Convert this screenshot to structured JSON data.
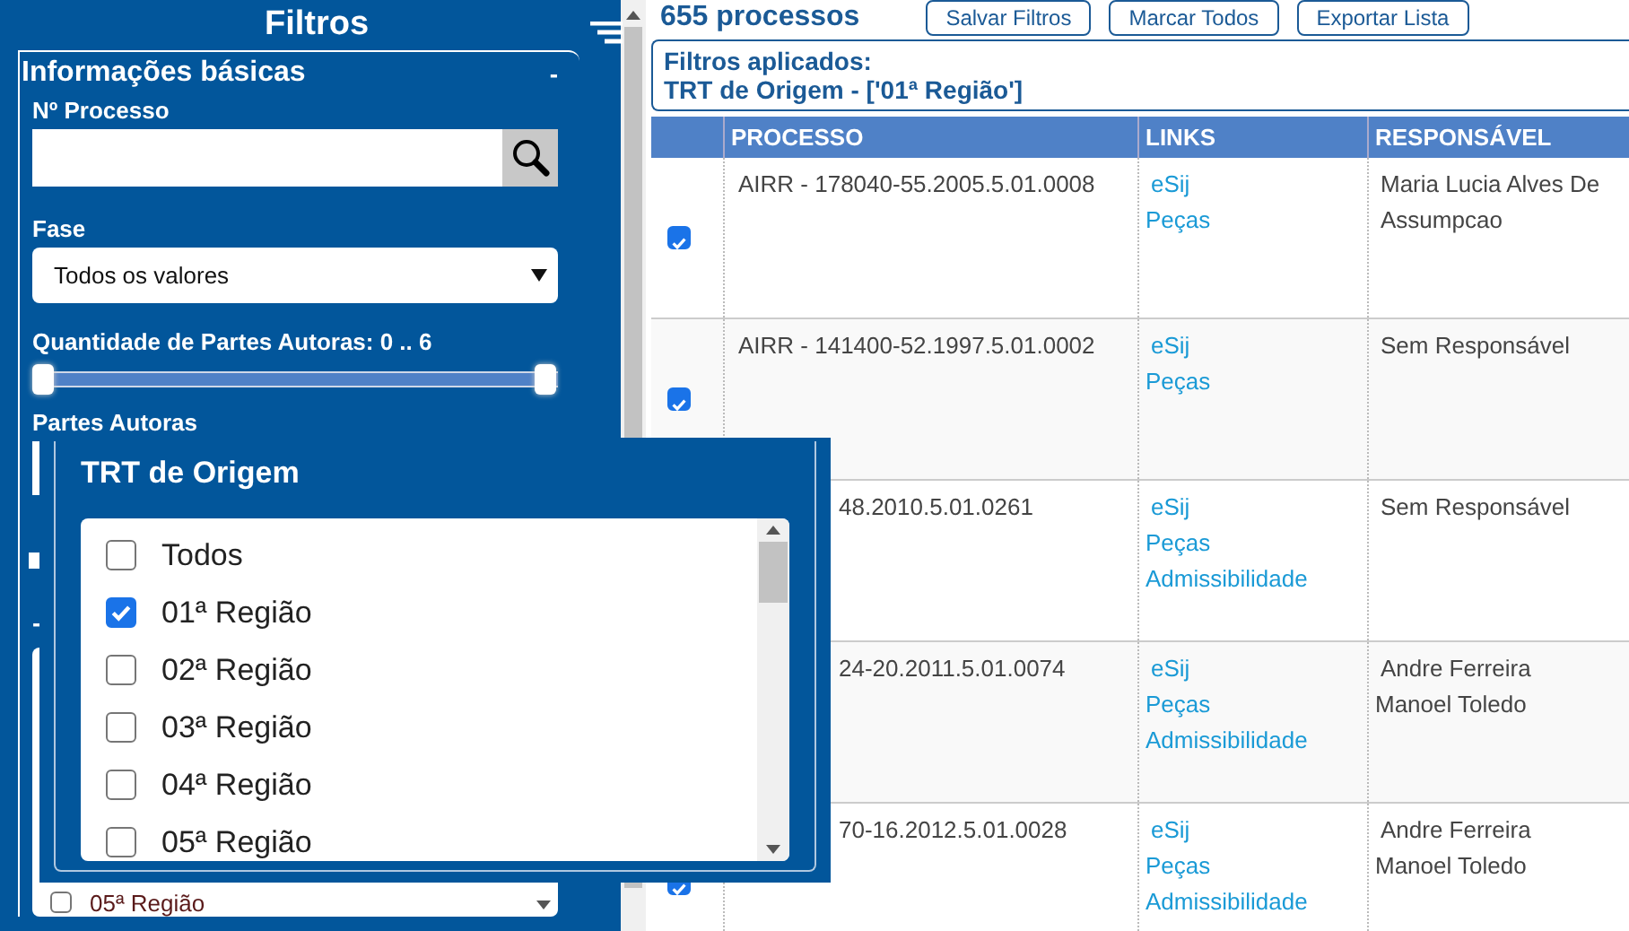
{
  "sidebar": {
    "title": "Filtros",
    "section": {
      "title": "Informações básicas",
      "collapse": "-",
      "process_field": {
        "label": "Nº Processo"
      },
      "phase": {
        "label": "Fase",
        "value": "Todos os valores"
      },
      "range": {
        "label": "Quantidade de Partes Autoras: 0 .. 6",
        "thumbs": [
          {
            "level": 0
          },
          {
            "level": 1
          }
        ]
      },
      "authors": {
        "label": "Partes Autoras"
      }
    },
    "covered": {
      "collapse": "-",
      "last_item": {
        "label": "05ª Região",
        "checked": false
      }
    }
  },
  "popup": {
    "title": "TRT de Origem",
    "options": [
      {
        "label": "Todos",
        "checked": false
      },
      {
        "label": "01ª Região",
        "checked": true
      },
      {
        "label": "02ª Região",
        "checked": false
      },
      {
        "label": "03ª Região",
        "checked": false
      },
      {
        "label": "04ª Região",
        "checked": false
      },
      {
        "label": "05ª Região",
        "checked": false
      }
    ]
  },
  "main": {
    "count": "655 processos",
    "buttons": [
      "Salvar Filtros",
      "Marcar Todos",
      "Exportar Lista"
    ],
    "applied": {
      "title": "Filtros aplicados:",
      "filter": "TRT de Origem - ['01ª Região']"
    },
    "table": {
      "columns": [
        "PROCESSO",
        "LINKS",
        "RESPONSÁVEL"
      ],
      "rows": [
        {
          "checked": true,
          "processo": "AIRR - 178040-55.2005.5.01.0008",
          "links": [
            "eSij",
            "Peças"
          ],
          "responsavel": [
            "Maria Lucia Alves De Assumpcao"
          ]
        },
        {
          "checked": true,
          "processo": "AIRR - 141400-52.1997.5.01.0002",
          "links": [
            "eSij",
            "Peças"
          ],
          "responsavel": [
            "Sem Responsável"
          ]
        },
        {
          "kind": "covered",
          "processo": "48.2010.5.01.0261",
          "links": [
            "eSij",
            "Peças",
            "Admissibilidade"
          ],
          "responsavel": [
            "Sem Responsável"
          ]
        },
        {
          "kind": "covered",
          "processo": "24-20.2011.5.01.0074",
          "links": [
            "eSij",
            "Peças",
            "Admissibilidade"
          ],
          "responsavel": [
            "Andre Ferreira",
            "Manoel Toledo"
          ]
        },
        {
          "kind": "covered",
          "checked": true,
          "processo": "70-16.2012.5.01.0028",
          "links": [
            "eSij",
            "Peças",
            "Admissibilidade"
          ],
          "responsavel": [
            "Andre Ferreira",
            "Manoel Toledo"
          ]
        }
      ]
    }
  }
}
